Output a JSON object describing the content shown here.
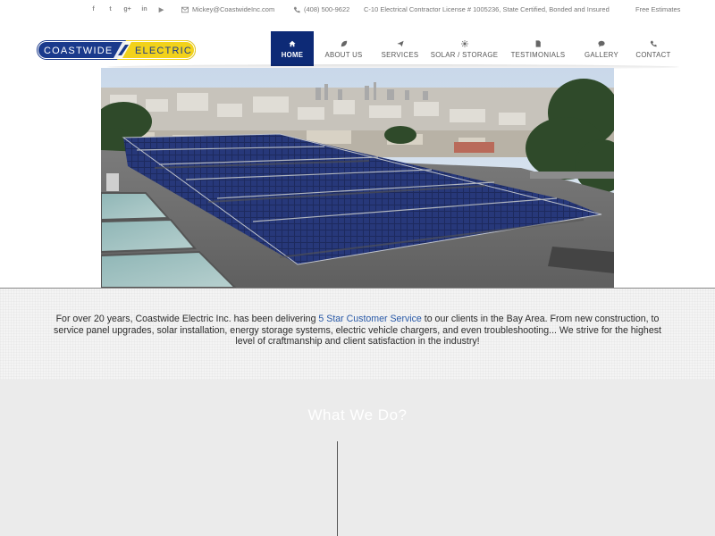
{
  "topbar": {
    "social_icons": [
      "facebook-icon",
      "twitter-icon",
      "google-plus-icon",
      "linkedin-icon",
      "youtube-icon"
    ],
    "social_glyphs": [
      "f",
      "t",
      "g+",
      "in",
      "▶"
    ],
    "email": "Mickey@CoastwideInc.com",
    "phone": "(408) 500-9622",
    "license": "C-10 Electrical Contractor License # 1005236, State Certified, Bonded and Insured",
    "estimates": "Free Estimates"
  },
  "logo": {
    "word1": "COASTWIDE",
    "word2": "ELECTRIC"
  },
  "nav": {
    "items": [
      {
        "label": "HOME",
        "icon": "home-icon",
        "active": true
      },
      {
        "label": "ABOUT US",
        "icon": "leaf-icon"
      },
      {
        "label": "SERVICES",
        "icon": "paper-plane-icon"
      },
      {
        "label": "SOLAR / STORAGE",
        "icon": "sun-icon"
      },
      {
        "label": "TESTIMONIALS",
        "icon": "document-icon"
      },
      {
        "label": "GALLERY",
        "icon": "comment-icon"
      },
      {
        "label": "CONTACT",
        "icon": "phone-icon"
      }
    ]
  },
  "intro": {
    "before": "For over 20 years, Coastwide Electric Inc. has been delivering",
    "link": "5 Star Customer Service",
    "after": "to our clients in the Bay Area. From new construction, to service panel upgrades, solar installation, energy storage systems, electric vehicle chargers, and even troubleshooting... We strive for the highest level of craftmanship and client satisfaction in the industry!"
  },
  "section": {
    "title": "What We Do?"
  },
  "colors": {
    "brand_blue": "#0d2a76",
    "logo_blue": "#1a3a8c",
    "logo_yellow": "#f2d21b",
    "link": "#2a5aa8"
  }
}
